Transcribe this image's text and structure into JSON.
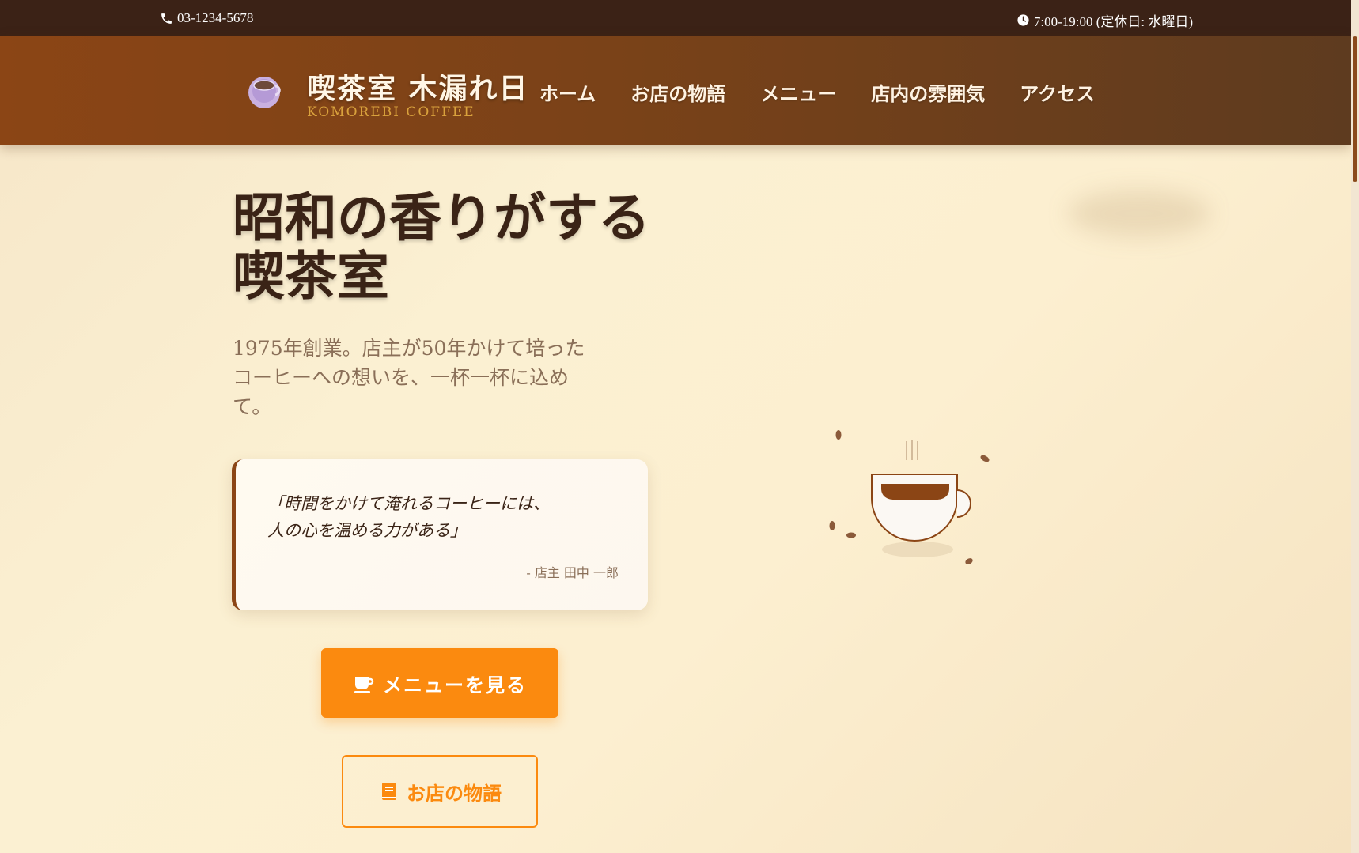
{
  "topbar": {
    "phone": "03-1234-5678",
    "phone_icon": "phone-icon",
    "hours": "7:00-19:00 (定休日: 水曜日)",
    "hours_icon": "clock-icon"
  },
  "brand": {
    "logo_icon": "coffee-cup-icon",
    "title": "喫茶室 木漏れ日",
    "subtitle": "KOMOREBI COFFEE"
  },
  "nav": {
    "items": [
      {
        "label": "ホーム"
      },
      {
        "label": "お店の物語"
      },
      {
        "label": "メニュー"
      },
      {
        "label": "店内の雰囲気"
      },
      {
        "label": "アクセス"
      }
    ]
  },
  "hero": {
    "title_line1": "昭和の香りがする",
    "title_line2": "喫茶室",
    "description": "1975年創業。店主が50年かけて培ったコーヒーへの想いを、一杯一杯に込めて。",
    "quote_line1": "「時間をかけて淹れるコーヒーには、",
    "quote_line2": "人の心を温める力がある」",
    "quote_author": "- 店主 田中 一郎",
    "primary_button": "メニューを見る",
    "primary_icon": "mug-icon",
    "secondary_button": "お店の物語",
    "secondary_icon": "book-icon",
    "illustration": "coffee-cup-illustration"
  },
  "colors": {
    "accent": "#fb8a0f",
    "brown": "#8b4515",
    "dark": "#3b2216",
    "gold": "#d9a23d"
  }
}
